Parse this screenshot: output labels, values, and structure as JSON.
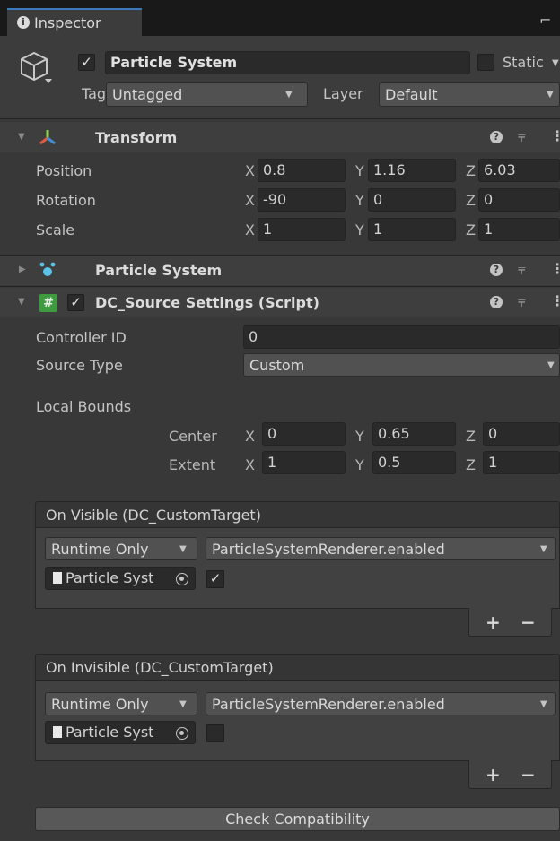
{
  "tab": {
    "title": "Inspector"
  },
  "gameobject": {
    "name": "Particle System",
    "static_label": "Static",
    "tag_label": "Tag",
    "tag_value": "Untagged",
    "layer_label": "Layer",
    "layer_value": "Default"
  },
  "transform": {
    "title": "Transform",
    "rows": [
      {
        "label": "Position",
        "x": "0.8",
        "y": "1.16",
        "z": "6.03"
      },
      {
        "label": "Rotation",
        "x": "-90",
        "y": "0",
        "z": "0"
      },
      {
        "label": "Scale",
        "x": "1",
        "y": "1",
        "z": "1"
      }
    ]
  },
  "axes": {
    "x": "X",
    "y": "Y",
    "z": "Z"
  },
  "particle_component": {
    "title": "Particle System"
  },
  "script_component": {
    "title": "DC_Source Settings (Script)",
    "controller_id_label": "Controller ID",
    "controller_id_value": "0",
    "source_type_label": "Source Type",
    "source_type_value": "Custom",
    "local_bounds_label": "Local Bounds",
    "center_label": "Center",
    "center": {
      "x": "0",
      "y": "0.65",
      "z": "0"
    },
    "extent_label": "Extent",
    "extent": {
      "x": "1",
      "y": "0.5",
      "z": "1"
    }
  },
  "on_visible": {
    "header": "On Visible (DC_CustomTarget)",
    "mode": "Runtime Only",
    "function": "ParticleSystemRenderer.enabled",
    "object": "Particle Syst",
    "value_checked": true
  },
  "on_invisible": {
    "header": "On Invisible (DC_CustomTarget)",
    "mode": "Runtime Only",
    "function": "ParticleSystemRenderer.enabled",
    "object": "Particle Syst",
    "value_checked": false
  },
  "buttons": {
    "plus": "+",
    "minus": "−",
    "check_compatibility": "Check Compatibility"
  },
  "colors": {
    "accent_tab": "#3a79bb",
    "panel_bg": "#383838",
    "field_bg": "#2a2a2a"
  }
}
